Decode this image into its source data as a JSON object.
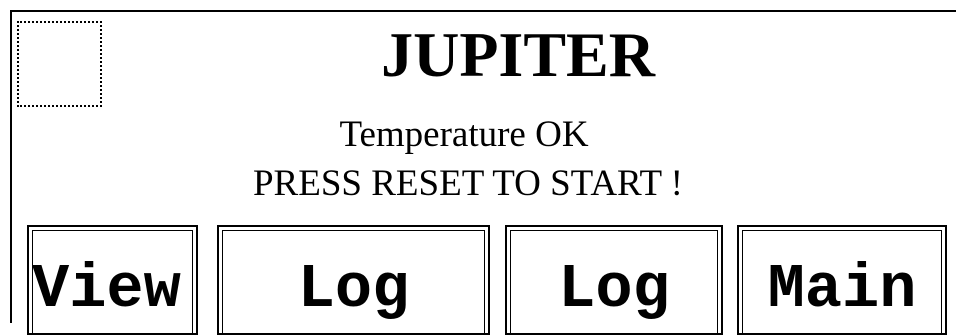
{
  "header": {
    "title": "JUPITER"
  },
  "status": {
    "line1": "Temperature OK",
    "line2": "PRESS RESET TO START !"
  },
  "buttons": {
    "view": "View",
    "log1": "Log",
    "log2": "Log",
    "main": "Main"
  }
}
